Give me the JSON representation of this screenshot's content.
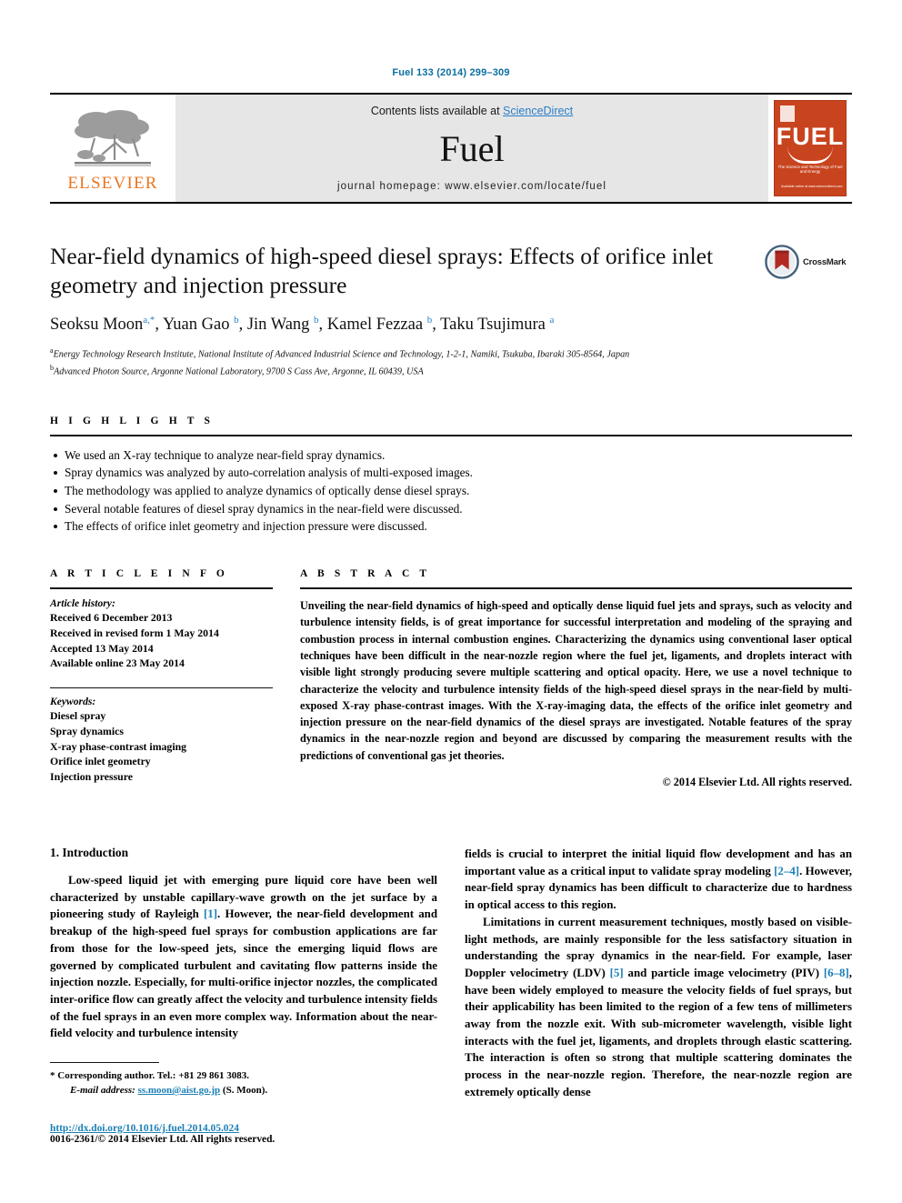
{
  "running_head": "Fuel 133 (2014) 299–309",
  "masthead": {
    "publisher_logo_label": "ELSEVIER",
    "contents_prefix": "Contents lists available at ",
    "sciencedirect_link": "ScienceDirect",
    "journal_title": "Fuel",
    "homepage_line": "journal homepage: www.elsevier.com/locate/fuel",
    "cover_title": "FUEL",
    "cover_subtitle": "The Science and Technology of Fuel and Energy",
    "cover_footer": "Available online at www.sciencedirect.com",
    "accent_orange": "#E87722",
    "cover_red": "#c8441f",
    "link_blue": "#2a7fc9"
  },
  "article": {
    "title": "Near-field dynamics of high-speed diesel sprays: Effects of orifice inlet geometry and injection pressure",
    "crossmark_label": "CrossMark",
    "authors_html": "Seoksu Moon<sup>a,</sup><sup>*</sup>, Yuan Gao <sup>b</sup>, Jin Wang <sup>b</sup>, Kamel Fezzaa <sup>b</sup>, Taku Tsujimura <sup>a</sup>",
    "affiliations": [
      "Energy Technology Research Institute, National Institute of Advanced Industrial Science and Technology, 1-2-1, Namiki, Tsukuba, Ibaraki 305-8564, Japan",
      "Advanced Photon Source, Argonne National Laboratory, 9700 S Cass Ave, Argonne, IL 60439, USA"
    ],
    "affiliation_marks": [
      "a",
      "b"
    ]
  },
  "highlights": {
    "heading": "H I G H L I G H T S",
    "items": [
      "We used an X-ray technique to analyze near-field spray dynamics.",
      "Spray dynamics was analyzed by auto-correlation analysis of multi-exposed images.",
      "The methodology was applied to analyze dynamics of optically dense diesel sprays.",
      "Several notable features of diesel spray dynamics in the near-field were discussed.",
      "The effects of orifice inlet geometry and injection pressure were discussed."
    ]
  },
  "article_info": {
    "heading": "A R T I C L E    I N F O",
    "history_label": "Article history:",
    "history": [
      "Received 6 December 2013",
      "Received in revised form 1 May 2014",
      "Accepted 13 May 2014",
      "Available online 23 May 2014"
    ],
    "keywords_label": "Keywords:",
    "keywords": [
      "Diesel spray",
      "Spray dynamics",
      "X-ray phase-contrast imaging",
      "Orifice inlet geometry",
      "Injection pressure"
    ]
  },
  "abstract": {
    "heading": "A B S T R A C T",
    "text": "Unveiling the near-field dynamics of high-speed and optically dense liquid fuel jets and sprays, such as velocity and turbulence intensity fields, is of great importance for successful interpretation and modeling of the spraying and combustion process in internal combustion engines. Characterizing the dynamics using conventional laser optical techniques have been difficult in the near-nozzle region where the fuel jet, ligaments, and droplets interact with visible light strongly producing severe multiple scattering and optical opacity. Here, we use a novel technique to characterize the velocity and turbulence intensity fields of the high-speed diesel sprays in the near-field by multi-exposed X-ray phase-contrast images. With the X-ray-imaging data, the effects of the orifice inlet geometry and injection pressure on the near-field dynamics of the diesel sprays are investigated. Notable features of the spray dynamics in the near-nozzle region and beyond are discussed by comparing the measurement results with the predictions of conventional gas jet theories.",
    "copyright": "© 2014 Elsevier Ltd. All rights reserved."
  },
  "body": {
    "section_number_title": "1. Introduction",
    "left_paragraph_1_a": "Low-speed liquid jet with emerging pure liquid core have been well characterized by unstable capillary-wave growth on the jet surface by a pioneering study of Rayleigh ",
    "left_ref_1": "[1]",
    "left_paragraph_1_b": ". However, the near-field development and breakup of the high-speed fuel sprays for combustion applications are far from those for the low-speed jets, since the emerging liquid flows are governed by complicated turbulent and cavitating flow patterns inside the injection nozzle. Especially, for multi-orifice injector nozzles, the complicated inter-orifice flow can greatly affect the velocity and turbulence intensity fields of the fuel sprays in an even more complex way. Information about the near-field velocity and turbulence intensity",
    "right_paragraph_1_a": "fields is crucial to interpret the initial liquid flow development and has an important value as a critical input to validate spray modeling ",
    "right_ref_24": "[2–4]",
    "right_paragraph_1_b": ". However, near-field spray dynamics has been difficult to characterize due to hardness in optical access to this region.",
    "right_paragraph_2_a": "Limitations in current measurement techniques, mostly based on visible-light methods, are mainly responsible for the less satisfactory situation in understanding the spray dynamics in the near-field. For example, laser Doppler velocimetry (LDV) ",
    "right_ref_5": "[5]",
    "right_paragraph_2_b": " and particle image velocimetry (PIV) ",
    "right_ref_68": "[6–8]",
    "right_paragraph_2_c": ", have been widely employed to measure the velocity fields of fuel sprays, but their applicability has been limited to the region of a few tens of millimeters away from the nozzle exit. With sub-micrometer wavelength, visible light interacts with the fuel jet, ligaments, and droplets through elastic scattering. The interaction is often so strong that multiple scattering dominates the process in the near-nozzle region. Therefore, the near-nozzle region are extremely optically dense"
  },
  "footer": {
    "corresponding_mark": "*",
    "corresponding_text": "Corresponding author. Tel.: +81 29 861 3083.",
    "email_label": "E-mail address:",
    "email": "ss.moon@aist.go.jp",
    "email_suffix": "(S. Moon).",
    "doi_url": "http://dx.doi.org/10.1016/j.fuel.2014.05.024",
    "issn_line": "0016-2361/© 2014 Elsevier Ltd. All rights reserved."
  }
}
